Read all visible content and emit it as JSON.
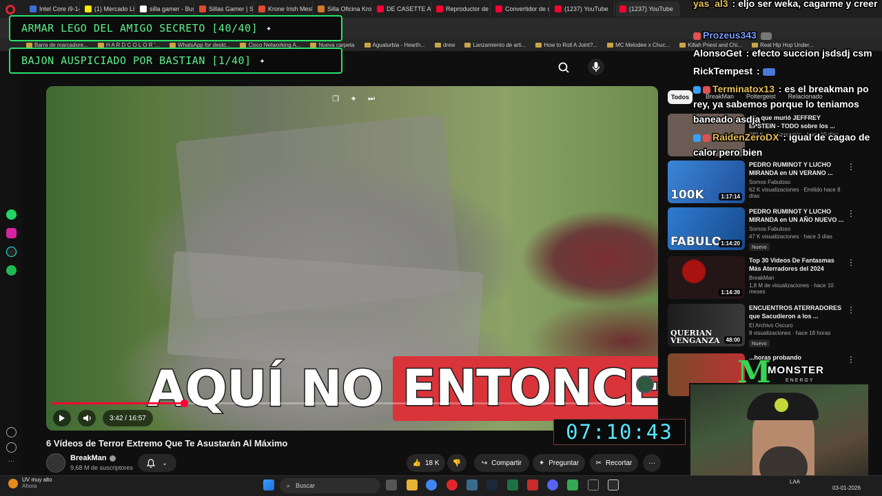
{
  "browser": {
    "tabs": [
      {
        "label": "Intel Core i9-1490...",
        "color": "#3b6fd8"
      },
      {
        "label": "(1) Mercado Libre",
        "color": "#ffe600"
      },
      {
        "label": "silla gamer - Busca...",
        "color": "#ffffff"
      },
      {
        "label": "Sillas Gamer | Solo...",
        "color": "#e04a2f"
      },
      {
        "label": "Krone Irish Mesh |...",
        "color": "#e04a2f"
      },
      {
        "label": "Silla Oficina Krone...",
        "color": "#d27a2a"
      },
      {
        "label": "DE CASETTE A MP...",
        "color": "#ff0033"
      },
      {
        "label": "Reproductor de ca...",
        "color": "#ff0033"
      },
      {
        "label": "Convertidor de cin...",
        "color": "#ff0033"
      },
      {
        "label": "(1237) YouTube",
        "color": "#ff0033"
      },
      {
        "label": "(1237) YouTube",
        "color": "#ff0033"
      }
    ],
    "bookmarks": [
      "Barra de marcadore...",
      "H A R D C O L O R '...",
      "WhatsApp for deskt...",
      "Cisco Networking A...",
      "Nueva carpeta",
      "Aguaturbia - Hearth...",
      "drew",
      "Lanzamiento de arti...",
      "How to Roll A Joint?...",
      "MC Melodee x Chuc...",
      "Killah Priest and Chi...",
      "Real Hip Hop Under..."
    ]
  },
  "overlay": {
    "goal1": "ARMAR LEGO DEL AMIGO SECRETO [40/40]",
    "goal2": "BAJON AUSPICIADO POR BASTIAN [1/40]",
    "timer": "07:10:43",
    "monster_word": "MONSTER",
    "monster_energy": "ENERGY"
  },
  "player": {
    "caption_left": "AQUÍ NO",
    "caption_right": "ENTONCES",
    "time": "3:42 / 16:57",
    "progress": 0.22,
    "colors": {
      "progress": "#ff0033",
      "caption_highlight": "#d8343a"
    }
  },
  "video": {
    "title": "6 Vídeos de Terror Extremo Que Te Asustarán Al Máximo",
    "channel": "BreakMan",
    "subscribers": "9,68 M de suscriptores",
    "likes": "18 K",
    "share": "Compartir",
    "ask": "Preguntar",
    "clip": "Recortar"
  },
  "sidebar_chips": {
    "all": "Todos",
    "others": [
      "BreakMan",
      "Poltergeist",
      "Relacionado"
    ]
  },
  "recommendations": [
    {
      "title": "...ía que murió JEFFREY EPSTEIN - TODO sobre los ...",
      "channel": "",
      "stats": "380 K visualizaciones · hace 10 días",
      "duration": "",
      "thumb_text": "",
      "badge": "",
      "thumb": "#6a5c54"
    },
    {
      "title": "PEDRO RUMINOT Y LUCHO MIRANDA en UN VERANO ...",
      "channel": "Somos Fabuloso",
      "stats": "62 K visualizaciones · Emitido hace 8 días",
      "duration": "1:17:14",
      "thumb_text": "100K",
      "badge": "",
      "thumb": "#3b86d8"
    },
    {
      "title": "PEDRO RUMINOT Y LUCHO MIRANDA en UN AÑO NUEVO ...",
      "channel": "Somos Fabuloso",
      "stats": "47 K visualizaciones · hace 3 días",
      "duration": "1:14:20",
      "thumb_text": "FABULO",
      "badge": "Nuevo",
      "thumb": "#2f7bd1"
    },
    {
      "title": "Top 30 Videos De Fantasmas Más Aterradores del 2024",
      "channel": "BreakMan",
      "stats": "1,8 M de visualizaciones · hace 10 meses",
      "duration": "1:14:39",
      "thumb_text": "",
      "badge": "",
      "thumb": "#241616"
    },
    {
      "title": "ENCUENTROS ATERRADORES que Sacudieron a los ...",
      "channel": "El Archivo Oscuro",
      "stats": "8 visualizaciones · hace 18 horas",
      "duration": "48:00",
      "thumb_text": "QUERIAN VENGANZA",
      "badge": "Nuevo",
      "thumb": "#1d1d1d"
    },
    {
      "title": "...horas probando",
      "channel": "",
      "stats": "",
      "duration": "",
      "thumb_text": "",
      "badge": "",
      "thumb": "#7a4a2a"
    }
  ],
  "chat": [
    {
      "user": "yas_al3",
      "text": "eljo ser weka, cagarme y creer",
      "color": "#ffffff"
    },
    {
      "user": "Prozeus343",
      "text": "",
      "color": "#7a9cff"
    },
    {
      "user": "AlonsoGet",
      "text": "efecto succion jsdsdj csm",
      "color": "#ffffff"
    },
    {
      "user": "RickTempest",
      "text": "",
      "color": "#ffffff"
    },
    {
      "user": "Terminatox13",
      "text": "es el breakman po rey, ya sabemos porque lo teniamos baneado asdja",
      "color": "#e8c05a"
    },
    {
      "user": "RaidenZeroDX",
      "text": "igual de cagao de calor pero bien",
      "color": "#e8c05a"
    }
  ],
  "taskbar": {
    "notif_title": "UV muy alto",
    "notif_sub": "Ahora",
    "search_placeholder": "Buscar",
    "tray": "LAA",
    "date": "03-01-2026"
  }
}
